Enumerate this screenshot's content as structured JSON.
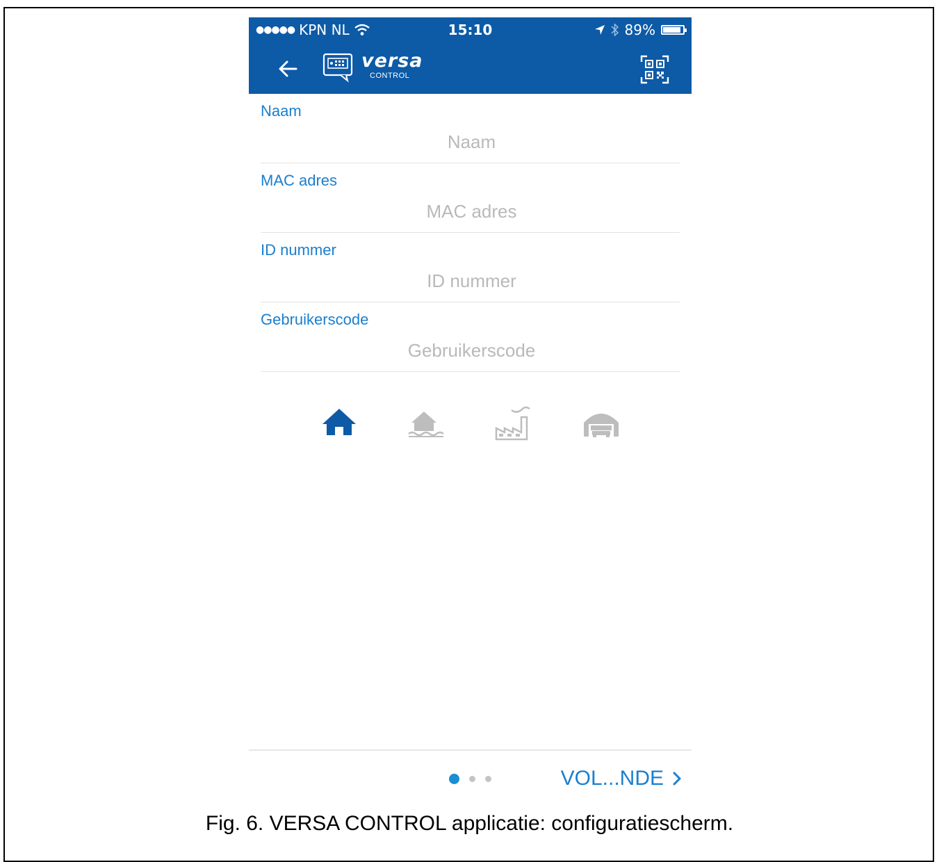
{
  "status_bar": {
    "carrier": "KPN NL",
    "time": "15:10",
    "battery_percent": "89%",
    "battery_level": 0.89,
    "icons": [
      "signal-dots-icon",
      "wifi-icon",
      "location-arrow-icon",
      "bluetooth-icon",
      "battery-icon"
    ]
  },
  "header": {
    "back_icon": "arrow-left-icon",
    "device_icon": "keypad-device-icon",
    "logo_word": "versa",
    "logo_sub": "CONTROL",
    "qr_icon": "qr-code-icon",
    "color": "#0d5aa7"
  },
  "form": {
    "fields": [
      {
        "label": "Naam",
        "placeholder": "Naam",
        "value": ""
      },
      {
        "label": "MAC adres",
        "placeholder": "MAC adres",
        "value": ""
      },
      {
        "label": "ID nummer",
        "placeholder": "ID nummer",
        "value": ""
      },
      {
        "label": "Gebruikerscode",
        "placeholder": "Gebruikerscode",
        "value": ""
      }
    ],
    "label_color": "#1a7fcf"
  },
  "object_types": {
    "items": [
      {
        "icon": "house-icon",
        "selected": true
      },
      {
        "icon": "house-by-water-icon",
        "selected": false
      },
      {
        "icon": "factory-icon",
        "selected": false
      },
      {
        "icon": "garage-icon",
        "selected": false
      }
    ],
    "selected_color": "#0d5aa7",
    "unselected_color": "#bdbdbd"
  },
  "footer": {
    "page_count": 3,
    "current_page": 1,
    "next_label": "VOL...NDE",
    "next_icon": "chevron-right-icon"
  },
  "caption": "Fig. 6. VERSA CONTROL applicatie: configuratiescherm."
}
